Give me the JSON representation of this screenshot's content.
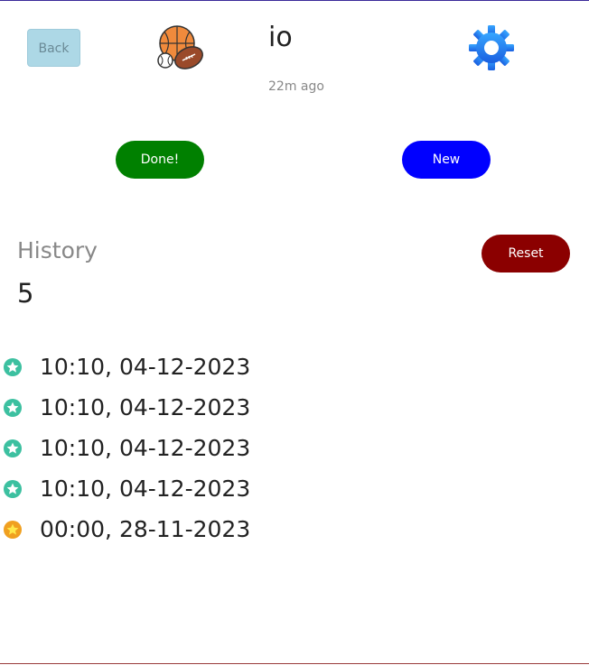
{
  "header": {
    "back_label": "Back",
    "title": "io",
    "elapsed": "22m ago",
    "category_icon": "sports-balls-icon",
    "settings_icon": "gear-icon"
  },
  "actions": {
    "done_label": "Done!",
    "new_label": "New",
    "reset_label": "Reset"
  },
  "history": {
    "heading": "History",
    "count": "5",
    "items": [
      {
        "time": "10:10, 04-12-2023",
        "badge": "teal-star-icon"
      },
      {
        "time": "10:10, 04-12-2023",
        "badge": "teal-star-icon"
      },
      {
        "time": "10:10, 04-12-2023",
        "badge": "teal-star-icon"
      },
      {
        "time": "10:10, 04-12-2023",
        "badge": "teal-star-icon"
      },
      {
        "time": "00:00, 28-11-2023",
        "badge": "orange-star-icon"
      }
    ]
  },
  "colors": {
    "done": "#008000",
    "new": "#0000ff",
    "reset": "#8b0000",
    "back": "#add8e6",
    "star_teal": "#3cc0a0",
    "star_orange": "#f0a020",
    "settings": "#2a8cf0"
  }
}
